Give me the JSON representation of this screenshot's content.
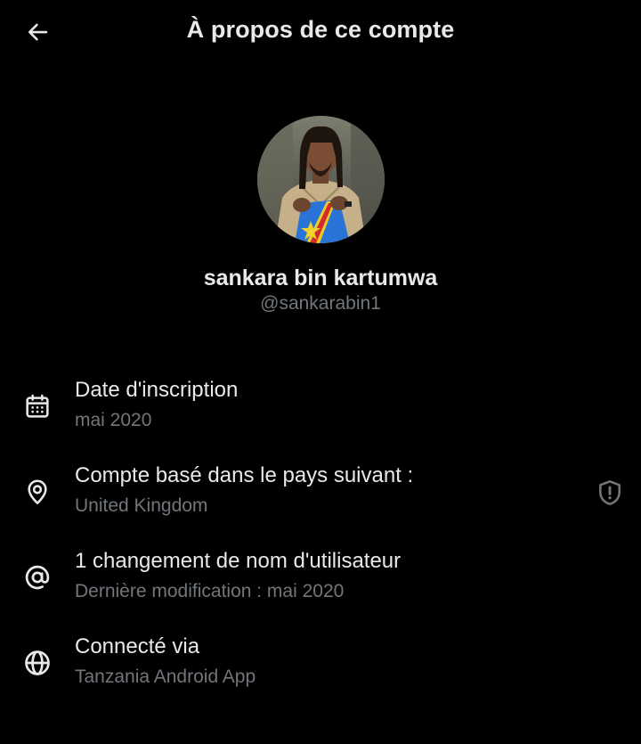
{
  "header": {
    "title": "À propos de ce compte"
  },
  "profile": {
    "display_name": "sankara bin kartumwa",
    "handle": "@sankarabin1"
  },
  "rows": [
    {
      "icon": "calendar-icon",
      "label": "Date d'inscription",
      "value": "mai 2020"
    },
    {
      "icon": "location-pin-icon",
      "label": "Compte basé dans le pays suivant :",
      "value": "United Kingdom",
      "trailing_icon": "shield-alert-icon"
    },
    {
      "icon": "at-sign-icon",
      "label": "1 changement de nom d'utilisateur",
      "value": "Dernière modification : mai 2020"
    },
    {
      "icon": "globe-icon",
      "label": "Connecté via",
      "value": "Tanzania Android App"
    }
  ],
  "colors": {
    "background": "#000000",
    "primary_text": "#e7e9ea",
    "secondary_text": "#71767b"
  }
}
